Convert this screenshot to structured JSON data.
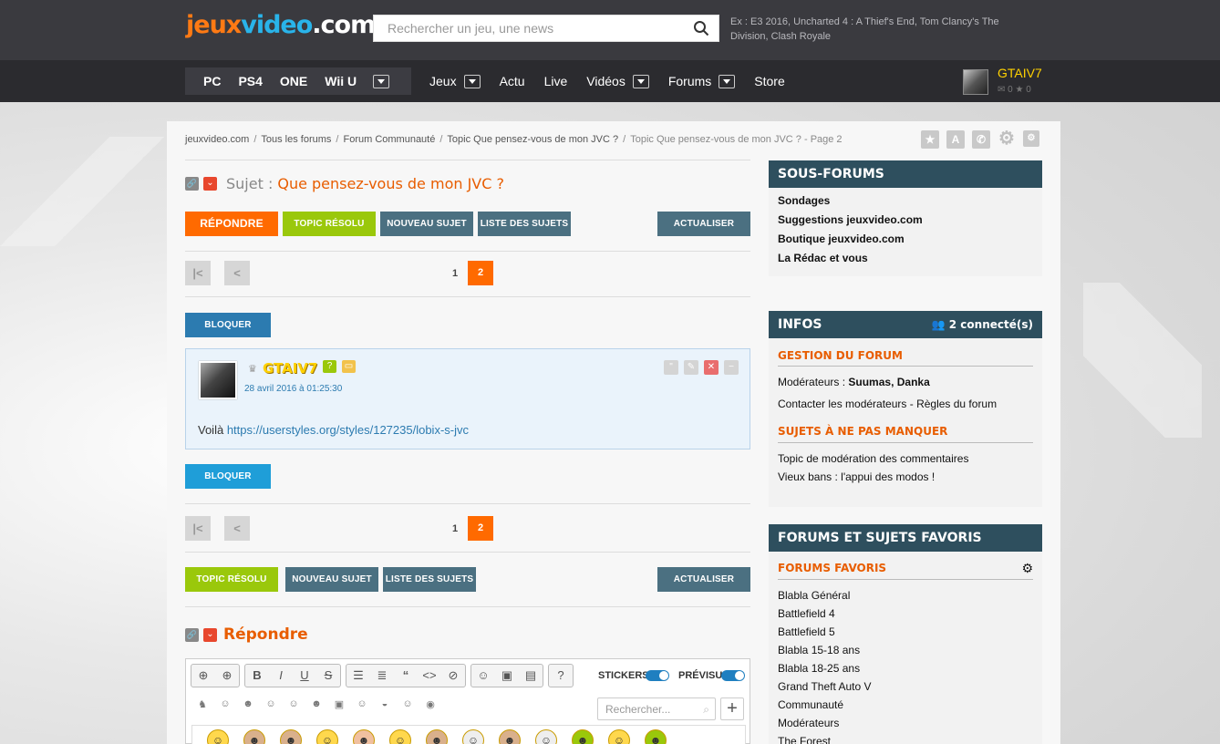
{
  "header": {
    "logo": {
      "part1": "jeux",
      "part2": "video",
      "part3": ".com"
    },
    "search_placeholder": "Rechercher un jeu, une news",
    "search_hint": "Ex : E3 2016, Uncharted 4 : A Thief's End, Tom Clancy's The Division, Clash Royale"
  },
  "nav": {
    "platforms": [
      "PC",
      "PS4",
      "ONE",
      "Wii U"
    ],
    "links": [
      "Jeux",
      "Actu",
      "Live",
      "Vidéos",
      "Forums",
      "Store"
    ],
    "user": {
      "name": "GTAIV7",
      "messages": "0",
      "favorites": "0"
    }
  },
  "breadcrumb": [
    "jeuxvideo.com",
    "Tous les forums",
    "Forum Communauté",
    "Topic Que pensez-vous de mon JVC ?",
    "Topic Que pensez-vous de mon JVC ? - Page 2"
  ],
  "topic": {
    "subject_label": "Sujet :",
    "title": "Que pensez-vous de mon JVC ?"
  },
  "buttons": {
    "reply": "RÉPONDRE",
    "resolved": "TOPIC RÉSOLU",
    "new_topic": "NOUVEAU SUJET",
    "topic_list": "LISTE DES SUJETS",
    "refresh": "ACTUALISER",
    "block": "BLOQUER"
  },
  "pagination": {
    "pages": [
      "1",
      "2"
    ],
    "current": "2"
  },
  "post": {
    "author": "GTAIV7",
    "date": "28 avril 2016 à 01:25:30",
    "text": "Voilà",
    "link": "https://userstyles.org/styles/127235/lobix-s-jvc"
  },
  "reply_section": {
    "title": "Répondre",
    "stickers_label": "STICKERS",
    "preview_label": "PRÉVISU",
    "search_placeholder": "Rechercher..."
  },
  "sidebar": {
    "subforums": {
      "title": "SOUS-FORUMS",
      "items": [
        "Sondages",
        "Suggestions jeuxvideo.com",
        "Boutique jeuxvideo.com",
        "La Rédac et vous"
      ]
    },
    "infos": {
      "title": "INFOS",
      "connected": "2 connecté(s)",
      "management_title": "GESTION DU FORUM",
      "moderators_label": "Modérateurs :",
      "moderators": "Suumas, Danka",
      "contact": "Contacter les modérateurs - Règles du forum",
      "musts_title": "SUJETS À NE PAS MANQUER",
      "musts": [
        "Topic de modération des commentaires",
        "Vieux bans : l'appui des modos !"
      ]
    },
    "favorites": {
      "title": "FORUMS ET SUJETS FAVORIS",
      "subtitle": "FORUMS FAVORIS",
      "items": [
        "Blabla Général",
        "Battlefield 4",
        "Battlefield 5",
        "Blabla 15-18 ans",
        "Blabla 18-25 ans",
        "Grand Theft Auto V",
        "Communauté",
        "Modérateurs",
        "The Forest"
      ]
    }
  },
  "colors": {
    "accent": "#ff6a00",
    "green": "#9ac80b",
    "slate": "#4b7081",
    "sidebar_head": "#2e4f5e",
    "link": "#2c7bb0"
  }
}
